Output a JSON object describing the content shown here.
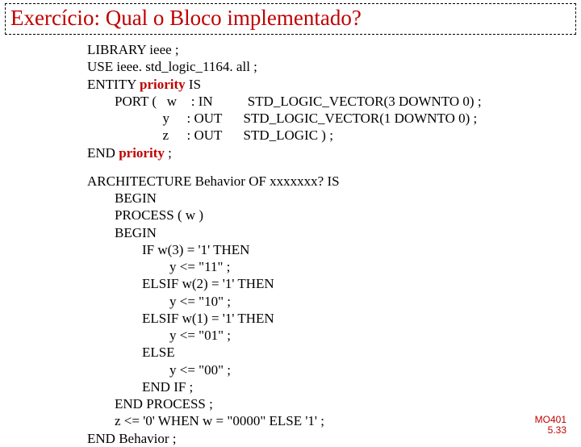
{
  "title": "Exercício: Qual o Bloco  implementado?",
  "entity": {
    "libLine": "LIBRARY ieee ;",
    "useLine": "USE ieee. std_logic_1164. all ;",
    "entityKw": "ENTITY ",
    "entityName": "priority",
    "entityIs": " IS",
    "portLead": "PORT (   ",
    "portSpacer": "              ",
    "ports": [
      {
        "name": "w",
        "dir": ": IN",
        "type": "STD_LOGIC_VECTOR(3 DOWNTO 0) ;"
      },
      {
        "name": "y",
        "dir": ": OUT",
        "type": "STD_LOGIC_VECTOR(1 DOWNTO 0) ;"
      },
      {
        "name": "z",
        "dir": ": OUT",
        "type": "STD_LOGIC ) ;"
      }
    ],
    "endKw": "END ",
    "endName": "priority",
    "endSemi": " ;"
  },
  "arch": {
    "head": "ARCHITECTURE Behavior OF xxxxxxx? IS",
    "begin1": "BEGIN",
    "process": "PROCESS ( w )",
    "begin2": "BEGIN",
    "if1": "IF w(3) = '1' THEN",
    "y11": "y <= \"11\" ;",
    "elsif2": "ELSIF w(2) = '1' THEN",
    "y10": "y <= \"10\" ;",
    "elsif1": "ELSIF w(1) = '1' THEN",
    "y01": "y <= \"01\" ;",
    "else": "ELSE",
    "y00": "y <= \"00\" ;",
    "endif": "END IF ;",
    "endprocess": "END PROCESS ;",
    "zline": "z <= '0' WHEN w = \"0000\" ELSE '1' ;",
    "endbeh": "END Behavior ;"
  },
  "footer": {
    "l1": "MO401",
    "l2": "5.33"
  }
}
